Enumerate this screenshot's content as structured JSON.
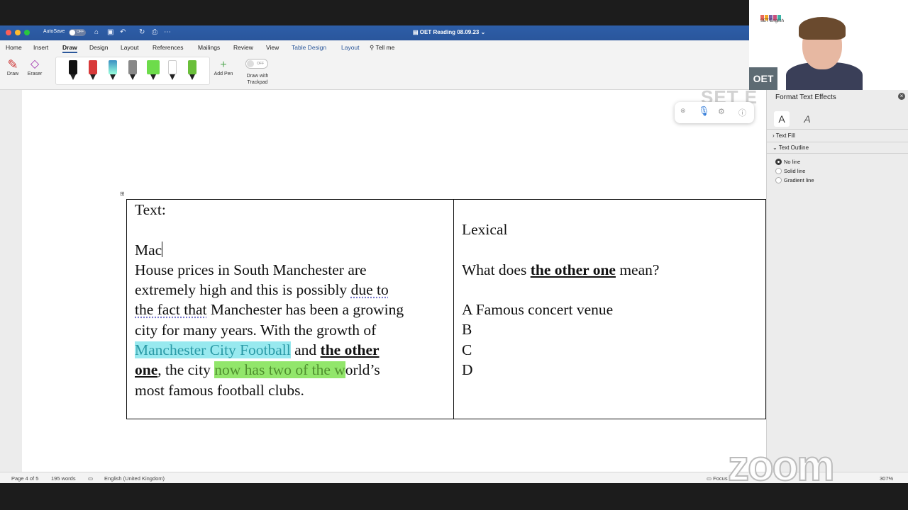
{
  "titlebar": {
    "autosave_label": "AutoSave",
    "autosave_state": "OFF",
    "doc_title": "OET Reading 08.09.23"
  },
  "ribbon": {
    "tabs": [
      {
        "label": "Home"
      },
      {
        "label": "Insert"
      },
      {
        "label": "Draw"
      },
      {
        "label": "Design"
      },
      {
        "label": "Layout"
      },
      {
        "label": "References"
      },
      {
        "label": "Mailings"
      },
      {
        "label": "Review"
      },
      {
        "label": "View"
      },
      {
        "label": "Table Design"
      },
      {
        "label": "Layout"
      },
      {
        "label": "Tell me"
      }
    ],
    "draw_label": "Draw",
    "eraser_label": "Eraser",
    "add_pen_label": "Add Pen",
    "trackpad_label_1": "Draw with",
    "trackpad_label_2": "Trackpad",
    "trackpad_state": "OFF",
    "pen_colors": [
      "#111111",
      "#d83a3a",
      "#3a8fc2",
      "#888888",
      "#6ddc4b",
      "#ffffff",
      "#6abf3a"
    ]
  },
  "document": {
    "left_cell": {
      "heading": "Text:",
      "typing": "Mac",
      "p1": "House prices in South Manchester are",
      "p2a": "extremely high and this is possibly ",
      "p2b": "due to",
      "p3a": "the fact that",
      "p3b": " Manchester has been a growing",
      "p4": "city for many years. With the growth of",
      "p5a": "Manchester City Football",
      "p5b": " and ",
      "p5c": "the other",
      "p6a": "one",
      "p6b": ", the city ",
      "p6c": "now has two of the w",
      "p6d": "orld’s",
      "p7": "most famous football clubs."
    },
    "right_cell": {
      "heading": "Lexical",
      "q_prefix": "What does ",
      "q_bold": "the other one",
      "q_suffix": " mean?",
      "opt_a": "A Famous concert venue",
      "opt_b": "B",
      "opt_c": "C",
      "opt_d": "D"
    }
  },
  "watermark_set": "SET E",
  "panel": {
    "title": "Format Text Effects",
    "close": "×",
    "tab1": "A",
    "tab2": "A",
    "section_fill": "Text Fill",
    "section_outline": "Text Outline",
    "options": [
      {
        "label": "No line",
        "selected": true
      },
      {
        "label": "Solid line",
        "selected": false
      },
      {
        "label": "Gradient line",
        "selected": false
      }
    ]
  },
  "video": {
    "logo_text": "SET English",
    "badge": "OET",
    "logo_colors": [
      "#e8665a",
      "#f5a623",
      "#7b5ea7",
      "#c94f7c",
      "#3bb3a6"
    ]
  },
  "statusbar": {
    "page": "Page 4 of 5",
    "words": "195 words",
    "language": "English (United Kingdom)",
    "focus": "Focus",
    "zoom": "307%"
  },
  "zoom_watermark": "zoom"
}
